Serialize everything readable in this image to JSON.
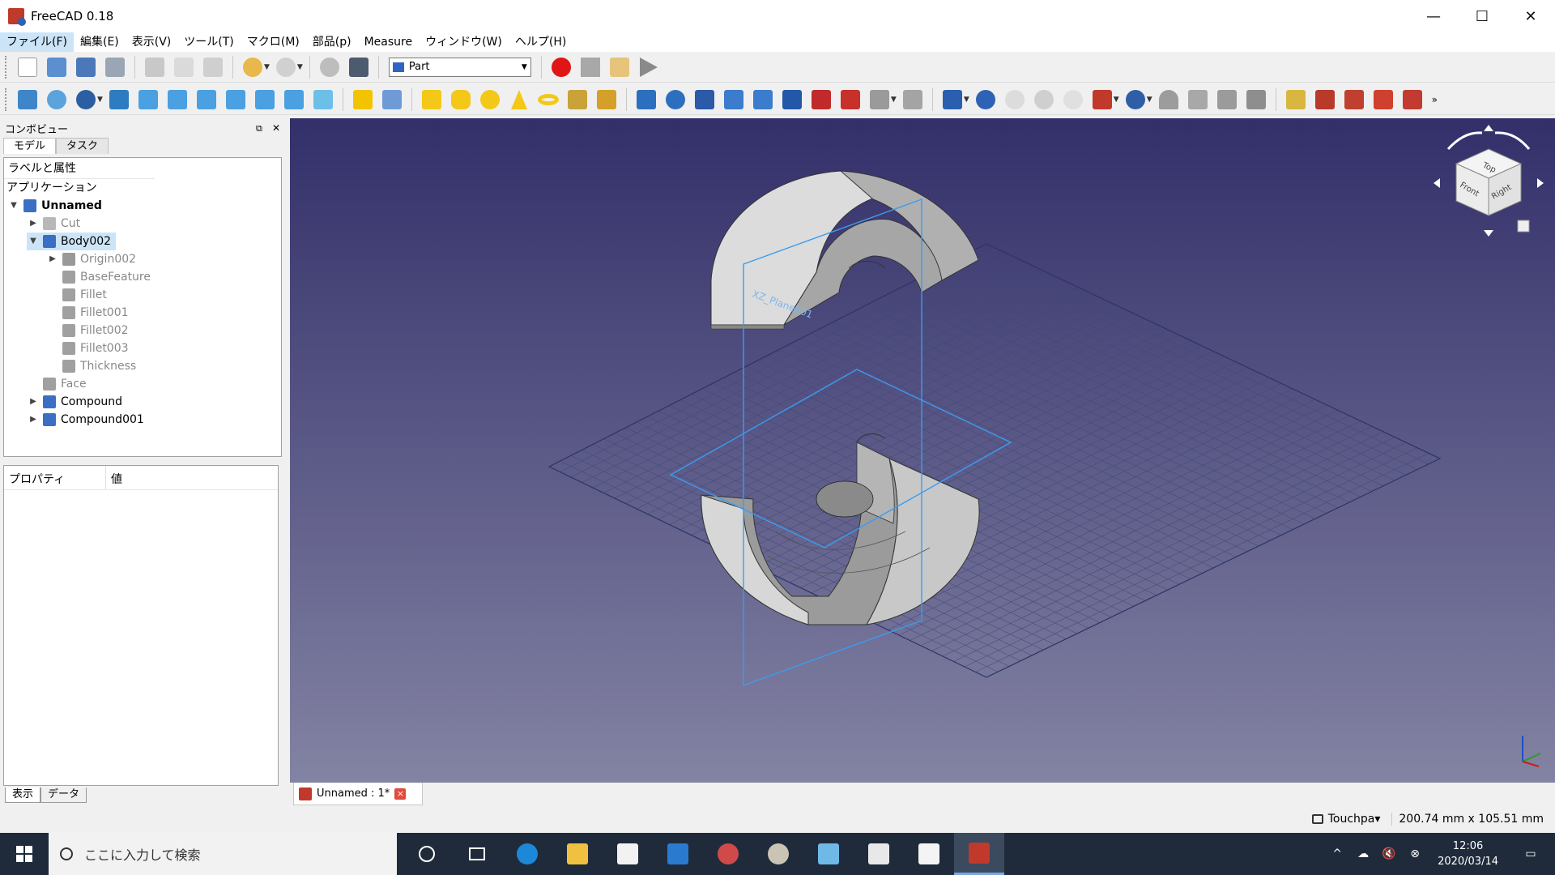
{
  "window": {
    "title": "FreeCAD 0.18",
    "minimize": "—",
    "maximize": "☐",
    "close": "✕"
  },
  "menu": [
    "ファイル(F)",
    "編集(E)",
    "表示(V)",
    "ツール(T)",
    "マクロ(M)",
    "部品(p)",
    "Measure",
    "ウィンドウ(W)",
    "ヘルプ(H)"
  ],
  "workbench": {
    "selected": "Part"
  },
  "combo": {
    "title": "コンボビュー",
    "tabs": [
      "モデル",
      "タスク"
    ],
    "tree_header": "ラベルと属性",
    "root_label": "アプリケーション",
    "items": [
      {
        "label": "Unnamed",
        "level": 0,
        "expanded": true,
        "bold": true,
        "dim": false,
        "color": "#3a6fc4"
      },
      {
        "label": "Cut",
        "level": 1,
        "expanded": false,
        "bold": false,
        "dim": true,
        "color": "#b8b8b8"
      },
      {
        "label": "Body002",
        "level": 1,
        "expanded": true,
        "bold": false,
        "dim": false,
        "selected": true,
        "color": "#3a6fc4"
      },
      {
        "label": "Origin002",
        "level": 2,
        "expanded": false,
        "bold": false,
        "dim": true,
        "color": "#999999"
      },
      {
        "label": "BaseFeature",
        "level": 2,
        "bold": false,
        "dim": true,
        "color": "#a0a0a0"
      },
      {
        "label": "Fillet",
        "level": 2,
        "bold": false,
        "dim": true,
        "color": "#a0a0a0"
      },
      {
        "label": "Fillet001",
        "level": 2,
        "bold": false,
        "dim": true,
        "color": "#a0a0a0"
      },
      {
        "label": "Fillet002",
        "level": 2,
        "bold": false,
        "dim": true,
        "color": "#a0a0a0"
      },
      {
        "label": "Fillet003",
        "level": 2,
        "bold": false,
        "dim": true,
        "color": "#a0a0a0"
      },
      {
        "label": "Thickness",
        "level": 2,
        "bold": false,
        "dim": true,
        "color": "#a0a0a0"
      },
      {
        "label": "Face",
        "level": 1,
        "bold": false,
        "dim": true,
        "color": "#a0a0a0"
      },
      {
        "label": "Compound",
        "level": 1,
        "expanded": false,
        "bold": false,
        "dim": false,
        "color": "#3a6fc4"
      },
      {
        "label": "Compound001",
        "level": 1,
        "expanded": false,
        "bold": false,
        "dim": false,
        "color": "#3a6fc4"
      }
    ],
    "props_headers": [
      "プロパティ",
      "値"
    ],
    "bottom_tabs": [
      "表示",
      "データ"
    ]
  },
  "document_tab": {
    "label": "Unnamed : 1*"
  },
  "navcube": {
    "top": "Top",
    "front": "Front",
    "right": "Right"
  },
  "plane_label": "XZ_Plane001",
  "status": {
    "navigation": "Touchpa▾",
    "dimensions": "200.74 mm x 105.51 mm"
  },
  "taskbar": {
    "search_placeholder": "ここに入力して検索",
    "time": "12:06",
    "date": "2020/03/14",
    "tray_chevron": "^",
    "tray_mute": "🔇"
  },
  "colors": {
    "viewport_top": "#332f6a",
    "viewport_bottom": "#8383a3",
    "selection": "#cce4f7"
  }
}
